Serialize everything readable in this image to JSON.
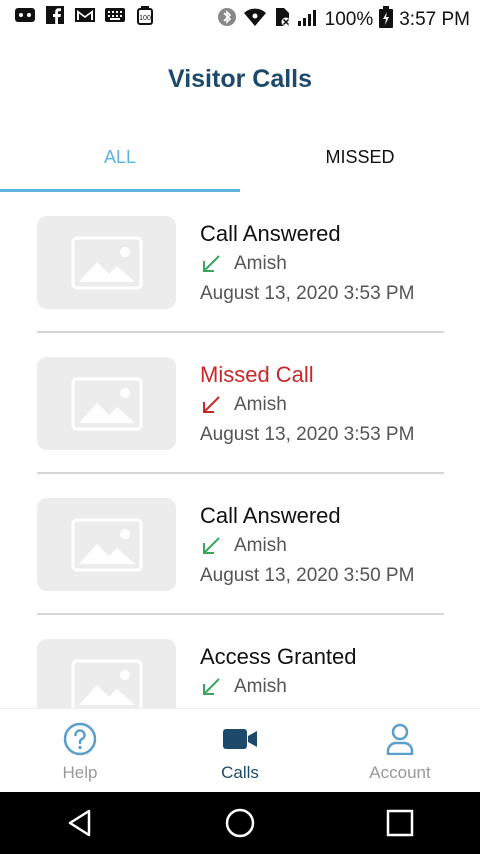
{
  "status_bar": {
    "left_icons": [
      "voicemail-icon",
      "facebook-icon",
      "gmail-icon",
      "keyboard-icon",
      "battery-saver-icon"
    ],
    "battery_percent": "100%",
    "time": "3:57 PM"
  },
  "header": {
    "title": "Visitor Calls"
  },
  "tabs": [
    {
      "label": "ALL",
      "active": true
    },
    {
      "label": "MISSED",
      "active": false
    }
  ],
  "calls": [
    {
      "title": "Call Answered",
      "status": "answered",
      "name": "Amish",
      "date": "August 13, 2020 3:53 PM"
    },
    {
      "title": "Missed Call",
      "status": "missed",
      "name": "Amish",
      "date": "August 13, 2020 3:53 PM"
    },
    {
      "title": "Call Answered",
      "status": "answered",
      "name": "Amish",
      "date": "August 13, 2020 3:50 PM"
    },
    {
      "title": "Access Granted",
      "status": "answered",
      "name": "Amish",
      "date": ""
    }
  ],
  "bottom_nav": [
    {
      "label": "Help",
      "icon": "help-circle-icon"
    },
    {
      "label": "Calls",
      "icon": "video-camera-icon",
      "active": true
    },
    {
      "label": "Account",
      "icon": "person-icon"
    }
  ],
  "colors": {
    "accent": "#5db3e0",
    "brand": "#1d4a6a",
    "missed": "#c62828",
    "answered": "#3aa55c"
  }
}
